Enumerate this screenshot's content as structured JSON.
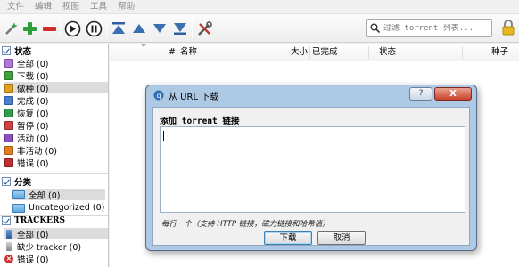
{
  "menubar": {
    "items": [
      "文件",
      "编辑",
      "视图",
      "工具",
      "帮助"
    ]
  },
  "toolbar": {
    "buttons": [
      "magic-icon",
      "add-icon",
      "remove-icon",
      "resume-icon",
      "pause-icon",
      "move-top-icon",
      "move-up-icon",
      "move-down-icon",
      "move-bottom-icon",
      "settings-icon"
    ],
    "search_placeholder": "过滤 torrent 列表..."
  },
  "sidebar": {
    "status_header": "状态",
    "status_items": [
      {
        "label": "全部 (0)",
        "color": "#b07ad6"
      },
      {
        "label": "下载 (0)",
        "color": "#3fa23f"
      },
      {
        "label": "做种 (0)",
        "color": "#e0a020"
      },
      {
        "label": "完成 (0)",
        "color": "#4a7fd0"
      },
      {
        "label": "恢复 (0)",
        "color": "#2e9e4a"
      },
      {
        "label": "暂停 (0)",
        "color": "#d04040"
      },
      {
        "label": "活动 (0)",
        "color": "#8a4fc0"
      },
      {
        "label": "非活动 (0)",
        "color": "#e08020"
      },
      {
        "label": "错误 (0)",
        "color": "#c03030"
      }
    ],
    "category_header": "分类",
    "category_items": [
      "全部  (0)",
      "Uncategorized  (0)"
    ],
    "trackers_header": "TRACKERS",
    "tracker_items": [
      "全部 (0)",
      "缺少 tracker (0)",
      "错误 (0)"
    ]
  },
  "list": {
    "columns": [
      "#",
      "名称",
      "大小",
      "已完成",
      "状态",
      "种子"
    ]
  },
  "dialog": {
    "title": "从 URL 下载",
    "help": "?",
    "close": "X",
    "label": "添加 torrent 链接",
    "text_value": "",
    "hint": "每行一个（支持 HTTP 链接，磁力链接和哈希值）",
    "ok": "下载",
    "cancel": "取消"
  }
}
